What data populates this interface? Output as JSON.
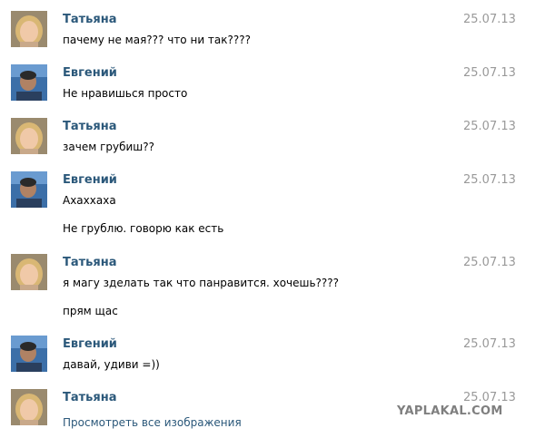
{
  "messages": [
    {
      "author": "Татьяна",
      "date": "25.07.13",
      "lines": [
        "пачему не мая??? что ни так????"
      ]
    },
    {
      "author": "Евгений",
      "date": "25.07.13",
      "lines": [
        "Не нравишься просто"
      ]
    },
    {
      "author": "Татьяна",
      "date": "25.07.13",
      "lines": [
        "зачем грубиш??"
      ]
    },
    {
      "author": "Евгений",
      "date": "25.07.13",
      "lines": [
        "Ахаххаха",
        "Не грублю. говорю как есть"
      ]
    },
    {
      "author": "Татьяна",
      "date": "25.07.13",
      "lines": [
        "я магу зделать так что панравится. хочешь????",
        "прям щас"
      ]
    },
    {
      "author": "Евгений",
      "date": "25.07.13",
      "lines": [
        "давай, удиви =))"
      ]
    },
    {
      "author": "Татьяна",
      "date": "25.07.13",
      "link": "Просмотреть все изображения"
    }
  ],
  "watermark": "YAPLAKAL.COM",
  "colors": {
    "author": "#2b587a",
    "date": "#999999",
    "text": "#000000",
    "watermark": "#7f7f7f"
  }
}
